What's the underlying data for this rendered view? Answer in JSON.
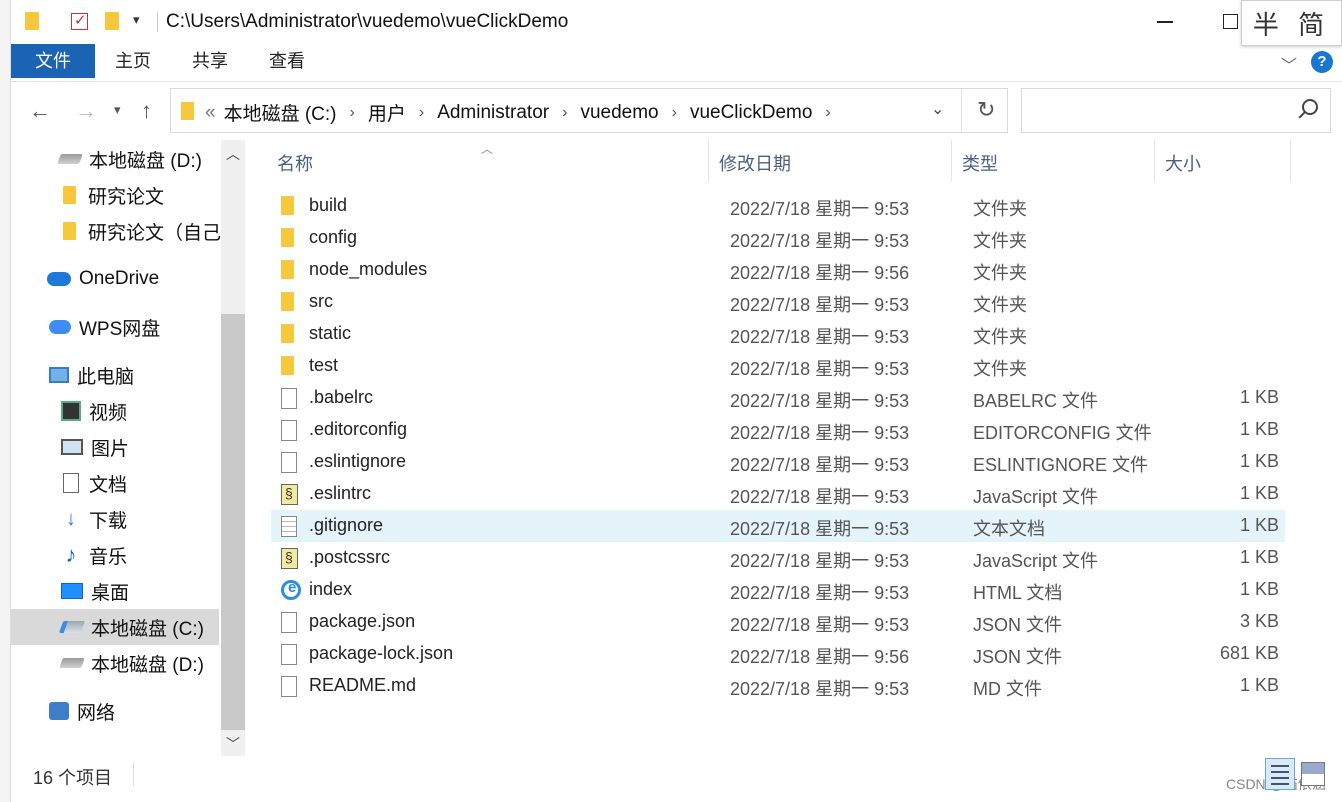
{
  "titlebar": {
    "path": "C:\\Users\\Administrator\\vuedemo\\vueClickDemo",
    "ime": "半 简"
  },
  "ribbon": {
    "tabs": [
      "文件",
      "主页",
      "共享",
      "查看"
    ],
    "help": "?"
  },
  "address": {
    "lead": "«",
    "crumbs": [
      "本地磁盘 (C:)",
      "用户",
      "Administrator",
      "vuedemo",
      "vueClickDemo"
    ]
  },
  "sidebar": {
    "items": [
      {
        "label": "本地磁盘 (D:)",
        "icon": "drive-icon"
      },
      {
        "label": "研究论文",
        "icon": "folder-icon"
      },
      {
        "label": "研究论文（自己)",
        "icon": "folder-icon"
      },
      {
        "label": "OneDrive",
        "icon": "onedrive-icon"
      },
      {
        "label": "WPS网盘",
        "icon": "wps-cloud-icon"
      },
      {
        "label": "此电脑",
        "icon": "computer-icon"
      },
      {
        "label": "视频",
        "icon": "video-icon"
      },
      {
        "label": "图片",
        "icon": "picture-icon"
      },
      {
        "label": "文档",
        "icon": "document-icon"
      },
      {
        "label": "下载",
        "icon": "download-icon"
      },
      {
        "label": "音乐",
        "icon": "music-icon"
      },
      {
        "label": "桌面",
        "icon": "desktop-icon"
      },
      {
        "label": "本地磁盘 (C:)",
        "icon": "system-drive-icon",
        "selected": true
      },
      {
        "label": "本地磁盘 (D:)",
        "icon": "drive-icon"
      },
      {
        "label": "网络",
        "icon": "network-icon"
      }
    ]
  },
  "columns": {
    "name": "名称",
    "date": "修改日期",
    "type": "类型",
    "size": "大小"
  },
  "files": [
    {
      "name": "build",
      "date": "2022/7/18 星期一 9:53",
      "type": "文件夹",
      "size": "",
      "icon": "folder-icon"
    },
    {
      "name": "config",
      "date": "2022/7/18 星期一 9:53",
      "type": "文件夹",
      "size": "",
      "icon": "folder-icon"
    },
    {
      "name": "node_modules",
      "date": "2022/7/18 星期一 9:56",
      "type": "文件夹",
      "size": "",
      "icon": "folder-icon"
    },
    {
      "name": "src",
      "date": "2022/7/18 星期一 9:53",
      "type": "文件夹",
      "size": "",
      "icon": "folder-icon"
    },
    {
      "name": "static",
      "date": "2022/7/18 星期一 9:53",
      "type": "文件夹",
      "size": "",
      "icon": "folder-icon"
    },
    {
      "name": "test",
      "date": "2022/7/18 星期一 9:53",
      "type": "文件夹",
      "size": "",
      "icon": "folder-icon"
    },
    {
      "name": ".babelrc",
      "date": "2022/7/18 星期一 9:53",
      "type": "BABELRC 文件",
      "size": "1 KB",
      "icon": "file-icon"
    },
    {
      "name": ".editorconfig",
      "date": "2022/7/18 星期一 9:53",
      "type": "EDITORCONFIG 文件",
      "size": "1 KB",
      "icon": "file-icon"
    },
    {
      "name": ".eslintignore",
      "date": "2022/7/18 星期一 9:53",
      "type": "ESLINTIGNORE 文件",
      "size": "1 KB",
      "icon": "file-icon"
    },
    {
      "name": ".eslintrc",
      "date": "2022/7/18 星期一 9:53",
      "type": "JavaScript 文件",
      "size": "1 KB",
      "icon": "js-file-icon"
    },
    {
      "name": ".gitignore",
      "date": "2022/7/18 星期一 9:53",
      "type": "文本文档",
      "size": "1 KB",
      "icon": "text-file-icon",
      "highlighted": true
    },
    {
      "name": ".postcssrc",
      "date": "2022/7/18 星期一 9:53",
      "type": "JavaScript 文件",
      "size": "1 KB",
      "icon": "js-file-icon"
    },
    {
      "name": "index",
      "date": "2022/7/18 星期一 9:53",
      "type": "HTML 文档",
      "size": "1 KB",
      "icon": "html-file-icon"
    },
    {
      "name": "package.json",
      "date": "2022/7/18 星期一 9:53",
      "type": "JSON 文件",
      "size": "3 KB",
      "icon": "file-icon"
    },
    {
      "name": "package-lock.json",
      "date": "2022/7/18 星期一 9:56",
      "type": "JSON 文件",
      "size": "681 KB",
      "icon": "file-icon"
    },
    {
      "name": "README.md",
      "date": "2022/7/18 星期一 9:53",
      "type": "MD 文件",
      "size": "1 KB",
      "icon": "file-icon"
    }
  ],
  "status": {
    "count": "16 个项目",
    "watermark": "CSDN @猫依涵"
  },
  "colors": {
    "accent": "#1a63b5",
    "header_text": "#4d6082",
    "folder": "#f8c83c",
    "highlight_row": "#e5f3fb"
  }
}
